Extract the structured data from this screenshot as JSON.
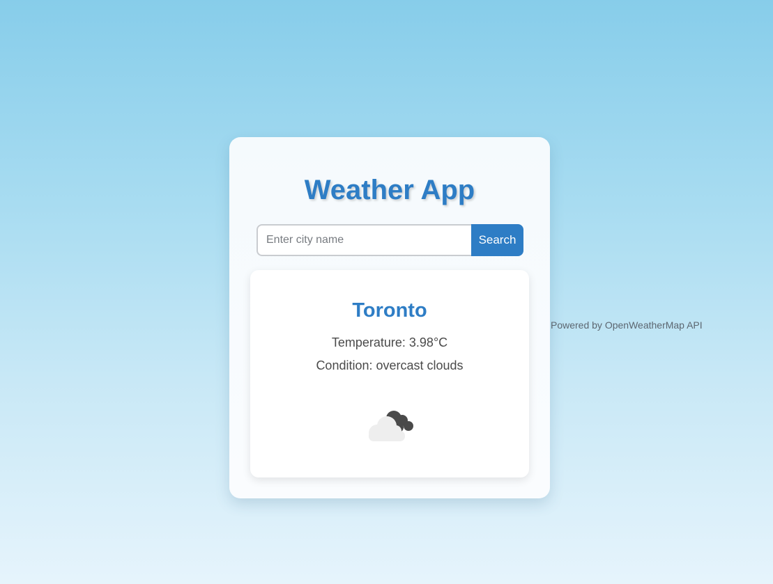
{
  "app": {
    "title": "Weather App"
  },
  "search": {
    "placeholder": "Enter city name",
    "value": "",
    "button_label": "Search"
  },
  "weather": {
    "city": "Toronto",
    "temperature_text": "Temperature: 3.98°C",
    "condition_text": "Condition: overcast clouds",
    "icon": "overcast-clouds-icon"
  },
  "footer": {
    "credit": "Powered by OpenWeatherMap API"
  },
  "colors": {
    "accent": "#2e7dc5",
    "text": "#4a4a4a",
    "background_top": "#87cdea",
    "background_bottom": "#e6f4fc"
  }
}
